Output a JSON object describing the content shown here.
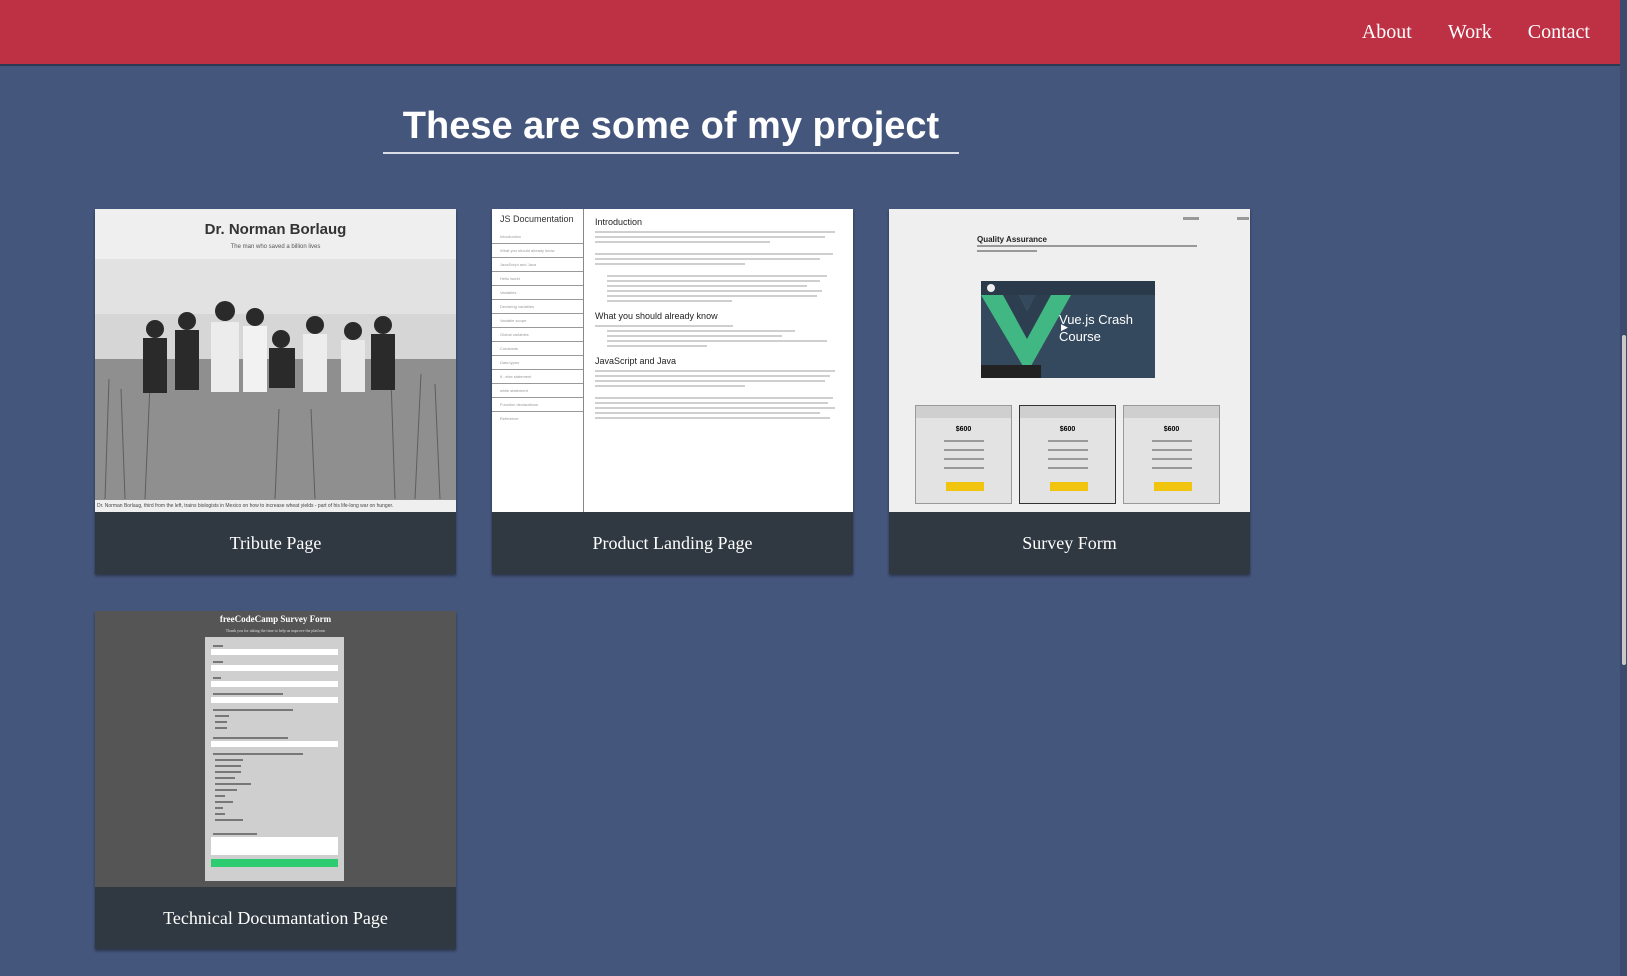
{
  "nav": {
    "about": "About",
    "work": "Work",
    "contact": "Contact"
  },
  "title": "These are some of my project",
  "projects": [
    {
      "caption": "Tribute Page",
      "preview": {
        "heading": "Dr. Norman Borlaug",
        "subheading": "The man who saved a billion lives",
        "photo_caption": "Dr. Norman Borlaug, third from the left, trains biologists in Mexico on how to increase wheat yields - part of his life-long war on hunger."
      }
    },
    {
      "caption": "Product Landing Page",
      "preview": {
        "sidebar_title": "JS Documentation",
        "sidebar_items": [
          "Introduction",
          "What you should already know",
          "JavaScript and Java",
          "Hello world",
          "Variables",
          "Declaring variables",
          "Variable scope",
          "Global variables",
          "Constants",
          "Data types",
          "if...else statement",
          "while statement",
          "Function declarations",
          "Reference"
        ],
        "sections": [
          "Introduction",
          "What you should already know",
          "JavaScript and Java"
        ]
      }
    },
    {
      "caption": "Survey Form",
      "preview": {
        "heading": "Quality Assurance",
        "video_title": "Vue.js Crash Course",
        "price": "$600"
      }
    },
    {
      "caption": "Technical Documantation Page",
      "preview": {
        "heading": "freeCodeCamp Survey Form",
        "subheading": "Thank you for taking the time to help us improve the platform"
      }
    }
  ],
  "colors": {
    "nav": "#be3144",
    "background": "#45567d",
    "card_footer": "#303841"
  }
}
